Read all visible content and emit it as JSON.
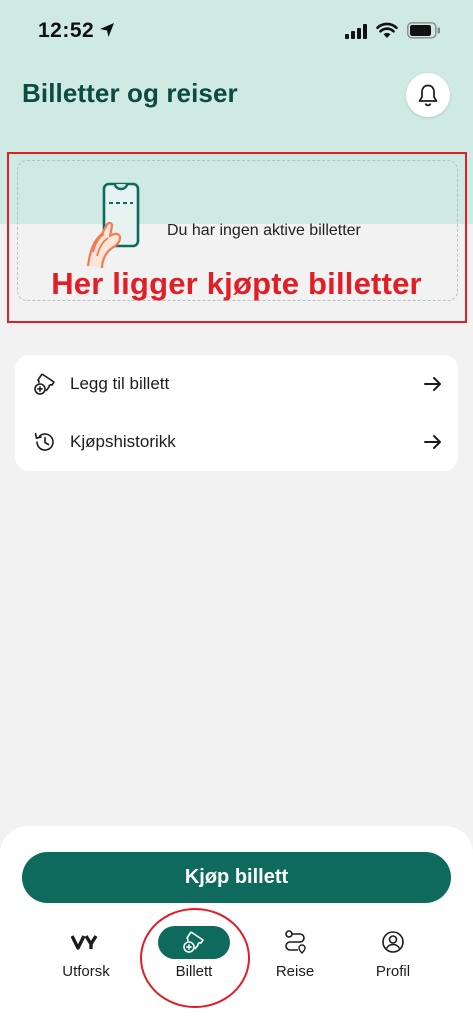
{
  "status_bar": {
    "time": "12:52"
  },
  "header": {
    "title": "Billetter og reiser",
    "notification_icon": "bell-icon"
  },
  "tickets": {
    "empty_text": "Du har ingen aktive billetter",
    "illustration": "hand-holding-ticket"
  },
  "annotation": {
    "text": "Her ligger kjøpte billetter",
    "color": "#e11e26"
  },
  "menu": {
    "items": [
      {
        "label": "Legg til billett",
        "icon": "ticket-add-icon",
        "arrow": "arrow-right-icon"
      },
      {
        "label": "Kjøpshistorikk",
        "icon": "history-icon",
        "arrow": "arrow-right-icon"
      }
    ]
  },
  "buy_button": {
    "label": "Kjøp billett"
  },
  "nav": {
    "items": [
      {
        "label": "Utforsk",
        "icon": "vy-logo-icon",
        "active": false
      },
      {
        "label": "Billett",
        "icon": "ticket-add-icon",
        "active": true
      },
      {
        "label": "Reise",
        "icon": "route-icon",
        "active": false
      },
      {
        "label": "Profil",
        "icon": "user-icon",
        "active": false
      }
    ]
  },
  "colors": {
    "primary": "#0e6a5c",
    "header_bg": "#cfe9e3",
    "title": "#0c4a42",
    "background": "#f2f2f2"
  }
}
